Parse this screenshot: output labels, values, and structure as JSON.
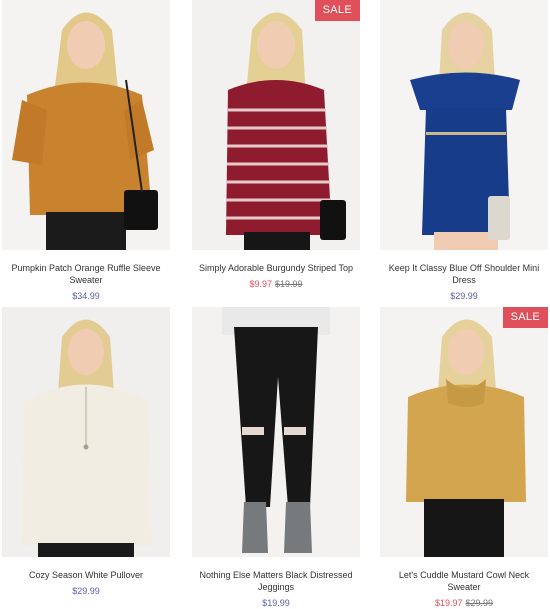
{
  "sale_color": "#e0505a",
  "price_color": "#5a5fa8",
  "products": [
    {
      "name": "Pumpkin Patch Orange Ruffle Sleeve Sweater",
      "price": "$34.99",
      "badge": "",
      "sale_price": "",
      "original_price": ""
    },
    {
      "name": "Simply Adorable Burgundy Striped Top",
      "price": "",
      "badge": "SALE",
      "sale_price": "$9.97",
      "original_price": "$19.99"
    },
    {
      "name": "Keep It Classy Blue Off Shoulder Mini Dress",
      "price": "$29.99",
      "badge": "",
      "sale_price": "",
      "original_price": ""
    },
    {
      "name": "Cozy Season White Pullover",
      "price": "$29.99",
      "badge": "",
      "sale_price": "",
      "original_price": ""
    },
    {
      "name": "Nothing Else Matters Black Distressed Jeggings",
      "price": "$19.99",
      "badge": "",
      "sale_price": "",
      "original_price": ""
    },
    {
      "name": "Let's Cuddle Mustard Cowl Neck Sweater",
      "price": "",
      "badge": "SALE",
      "sale_price": "$19.97",
      "original_price": "$29.99"
    }
  ]
}
